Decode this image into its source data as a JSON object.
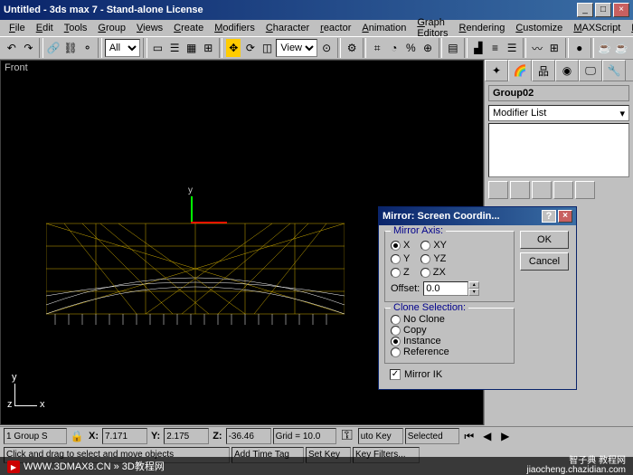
{
  "title": "Untitled - 3ds max 7 - Stand-alone License",
  "titlebar_buttons": {
    "min": "_",
    "max": "□",
    "close": "×"
  },
  "menu": [
    "File",
    "Edit",
    "Tools",
    "Group",
    "Views",
    "Create",
    "Modifiers",
    "Character",
    "reactor",
    "Animation",
    "Graph Editors",
    "Rendering",
    "Customize",
    "MAXScript",
    "Help"
  ],
  "toolbar": {
    "selection_filter": "All",
    "refcoord": "View"
  },
  "viewport": {
    "label": "Front",
    "gizmo_y": "y",
    "axis_x": "x",
    "axis_y": "y",
    "axis_z": "z"
  },
  "cmdpanel": {
    "object_name": "Group02",
    "modifier_list": "Modifier List"
  },
  "dialog": {
    "title": "Mirror: Screen Coordin...",
    "ok": "OK",
    "cancel": "Cancel",
    "group_axis": "Mirror Axis:",
    "axis": {
      "x": "X",
      "y": "Y",
      "z": "Z",
      "xy": "XY",
      "yz": "YZ",
      "zx": "ZX"
    },
    "offset_label": "Offset:",
    "offset_value": "0.0",
    "group_clone": "Clone Selection:",
    "clone": {
      "none": "No Clone",
      "copy": "Copy",
      "instance": "Instance",
      "reference": "Reference"
    },
    "mirror_ik": "Mirror IK"
  },
  "status": {
    "selection": "1 Group S",
    "x": "7.171",
    "y": "2.175",
    "z": "-36.46",
    "grid": "Grid = 10.0",
    "prompt": "Click and drag to select and move objects",
    "addtime": "Add Time Tag",
    "autokey": "uto Key",
    "selected_filter": "Selected",
    "setkey": "Set Key",
    "keyfilters": "Key Filters..."
  },
  "watermark": {
    "left": "WWW.3DMAX8.CN » 3D教程网",
    "right": "智子典 教程网\njiaocheng.chazidian.com"
  }
}
